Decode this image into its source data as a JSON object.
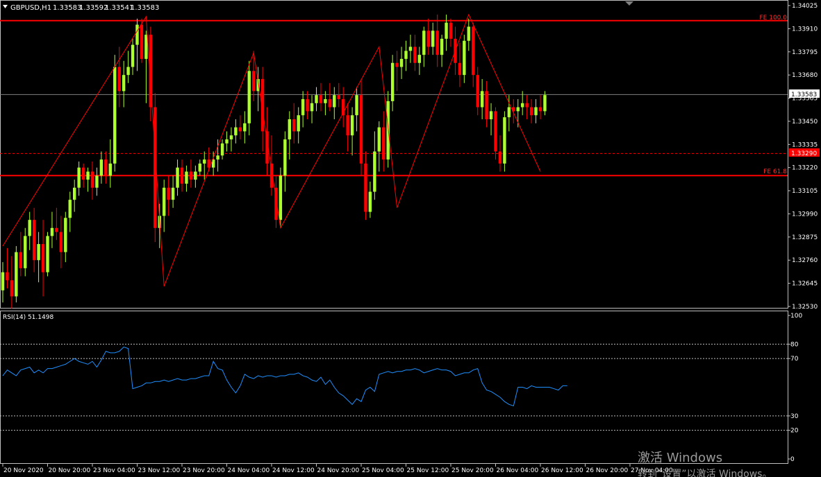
{
  "symbol_header": {
    "symbol": "GBPUSD,H1",
    "open": "1.33583",
    "high": "1.33592",
    "low": "1.33541",
    "close": "1.33583"
  },
  "price_axis": {
    "ticks": [
      "1.34025",
      "1.33910",
      "1.33795",
      "1.33680",
      "1.33565",
      "1.33450",
      "1.33335",
      "1.33220",
      "1.33105",
      "1.32990",
      "1.32875",
      "1.32760",
      "1.32645",
      "1.32530"
    ],
    "current_price_label": "1.33583",
    "dashed_level_label": "1.33290"
  },
  "fe_levels": [
    {
      "label": "FE 100.0",
      "price": 1.3395
    },
    {
      "label": "FE 61.8",
      "price": 1.3318
    }
  ],
  "time_axis": {
    "labels": [
      "20 Nov 2020",
      "20 Nov 20:00",
      "23 Nov 04:00",
      "23 Nov 12:00",
      "23 Nov 20:00",
      "24 Nov 04:00",
      "24 Nov 12:00",
      "24 Nov 20:00",
      "25 Nov 04:00",
      "25 Nov 12:00",
      "25 Nov 20:00",
      "26 Nov 04:00",
      "26 Nov 12:00",
      "26 Nov 20:00",
      "27 Nov 04:00"
    ]
  },
  "rsi_panel": {
    "label": "RSI(14) 51.1498",
    "ticks": [
      "100",
      "80",
      "70",
      "30",
      "20",
      "0"
    ],
    "levels": [
      80,
      70,
      30,
      20
    ]
  },
  "watermark": {
    "line1": "激活 Windows",
    "line2": "转到“设置”以激活 Windows。"
  },
  "colors": {
    "background": "#000000",
    "bull": "#adff2f",
    "bear": "#ff0000",
    "fe_line": "#ff0000",
    "zigzag": "#ff0000",
    "rsi_line": "#1e90ff",
    "axis_text": "#ffffff",
    "price_marker_bg": "#ffffff",
    "level_marker_bg": "#ff0000"
  },
  "chart_data": {
    "type": "candlestick",
    "title": "GBPUSD,H1",
    "ylim": [
      1.3253,
      1.34025
    ],
    "candles": [
      [
        1.3261,
        1.3275,
        1.3255,
        1.327
      ],
      [
        1.327,
        1.3282,
        1.3262,
        1.3266
      ],
      [
        1.3266,
        1.3278,
        1.3252,
        1.3258
      ],
      [
        1.3258,
        1.3283,
        1.3255,
        1.328
      ],
      [
        1.328,
        1.329,
        1.3268,
        1.3272
      ],
      [
        1.3272,
        1.3292,
        1.3268,
        1.3288
      ],
      [
        1.3288,
        1.33,
        1.3281,
        1.3296
      ],
      [
        1.3296,
        1.3302,
        1.327,
        1.3276
      ],
      [
        1.3276,
        1.329,
        1.3265,
        1.3284
      ],
      [
        1.3284,
        1.3296,
        1.3258,
        1.327
      ],
      [
        1.327,
        1.329,
        1.3268,
        1.3288
      ],
      [
        1.3288,
        1.33,
        1.3282,
        1.3292
      ],
      [
        1.3292,
        1.3302,
        1.3286,
        1.329
      ],
      [
        1.329,
        1.3298,
        1.3272,
        1.328
      ],
      [
        1.328,
        1.33,
        1.3275,
        1.3297
      ],
      [
        1.3297,
        1.331,
        1.329,
        1.3306
      ],
      [
        1.3306,
        1.3316,
        1.33,
        1.3312
      ],
      [
        1.3312,
        1.3325,
        1.3308,
        1.3322
      ],
      [
        1.3322,
        1.3324,
        1.3312,
        1.3316
      ],
      [
        1.3316,
        1.3322,
        1.331,
        1.332
      ],
      [
        1.332,
        1.3325,
        1.3306,
        1.3312
      ],
      [
        1.3312,
        1.3322,
        1.3308,
        1.3318
      ],
      [
        1.3318,
        1.333,
        1.3314,
        1.3326
      ],
      [
        1.3326,
        1.333,
        1.3314,
        1.3318
      ],
      [
        1.3318,
        1.3336,
        1.3312,
        1.3324
      ],
      [
        1.3324,
        1.3378,
        1.332,
        1.3372
      ],
      [
        1.3372,
        1.3382,
        1.3352,
        1.336
      ],
      [
        1.336,
        1.3375,
        1.3352,
        1.3368
      ],
      [
        1.3368,
        1.338,
        1.3364,
        1.3372
      ],
      [
        1.3372,
        1.3386,
        1.3368,
        1.3383
      ],
      [
        1.3383,
        1.3396,
        1.337,
        1.3393
      ],
      [
        1.3393,
        1.3396,
        1.3374,
        1.3376
      ],
      [
        1.3376,
        1.339,
        1.3354,
        1.3388
      ],
      [
        1.3388,
        1.3392,
        1.3345,
        1.3352
      ],
      [
        1.3352,
        1.3359,
        1.3285,
        1.3292
      ],
      [
        1.3292,
        1.3304,
        1.3282,
        1.3298
      ],
      [
        1.3298,
        1.3316,
        1.329,
        1.3312
      ],
      [
        1.3312,
        1.3318,
        1.3298,
        1.3306
      ],
      [
        1.3306,
        1.3318,
        1.3302,
        1.3312
      ],
      [
        1.3312,
        1.3326,
        1.3308,
        1.3322
      ],
      [
        1.3322,
        1.3326,
        1.331,
        1.3314
      ],
      [
        1.3314,
        1.3323,
        1.331,
        1.332
      ],
      [
        1.332,
        1.3326,
        1.3312,
        1.3316
      ],
      [
        1.3316,
        1.3323,
        1.3312,
        1.332
      ],
      [
        1.332,
        1.3326,
        1.3318,
        1.3324
      ],
      [
        1.3324,
        1.333,
        1.3316,
        1.3326
      ],
      [
        1.3326,
        1.3332,
        1.332,
        1.3322
      ],
      [
        1.3322,
        1.333,
        1.3318,
        1.3326
      ],
      [
        1.3326,
        1.3336,
        1.332,
        1.3328
      ],
      [
        1.3328,
        1.3336,
        1.3326,
        1.3334
      ],
      [
        1.3334,
        1.334,
        1.333,
        1.3336
      ],
      [
        1.3336,
        1.3342,
        1.333,
        1.3338
      ],
      [
        1.3338,
        1.3346,
        1.3334,
        1.3342
      ],
      [
        1.3342,
        1.3348,
        1.3336,
        1.334
      ],
      [
        1.334,
        1.335,
        1.3334,
        1.3344
      ],
      [
        1.3344,
        1.3375,
        1.3338,
        1.337
      ],
      [
        1.337,
        1.338,
        1.3355,
        1.336
      ],
      [
        1.336,
        1.3372,
        1.335,
        1.3366
      ],
      [
        1.3366,
        1.3372,
        1.333,
        1.334
      ],
      [
        1.334,
        1.3352,
        1.3318,
        1.3324
      ],
      [
        1.3324,
        1.3338,
        1.3308,
        1.3312
      ],
      [
        1.3312,
        1.3318,
        1.3292,
        1.3296
      ],
      [
        1.3296,
        1.3322,
        1.3292,
        1.3318
      ],
      [
        1.3318,
        1.334,
        1.331,
        1.3336
      ],
      [
        1.3336,
        1.335,
        1.3326,
        1.3346
      ],
      [
        1.3346,
        1.3354,
        1.3334,
        1.334
      ],
      [
        1.334,
        1.3352,
        1.3334,
        1.3348
      ],
      [
        1.3348,
        1.336,
        1.3342,
        1.3356
      ],
      [
        1.3356,
        1.336,
        1.3346,
        1.335
      ],
      [
        1.335,
        1.3358,
        1.3344,
        1.3354
      ],
      [
        1.3354,
        1.3362,
        1.335,
        1.3358
      ],
      [
        1.3358,
        1.3364,
        1.335,
        1.3354
      ],
      [
        1.3354,
        1.336,
        1.3348,
        1.3356
      ],
      [
        1.3356,
        1.3364,
        1.335,
        1.3352
      ],
      [
        1.3352,
        1.3362,
        1.3346,
        1.3358
      ],
      [
        1.3358,
        1.3364,
        1.3352,
        1.3356
      ],
      [
        1.3356,
        1.3362,
        1.3342,
        1.3348
      ],
      [
        1.3348,
        1.3354,
        1.333,
        1.3338
      ],
      [
        1.3338,
        1.3352,
        1.3328,
        1.3348
      ],
      [
        1.3348,
        1.3362,
        1.334,
        1.3358
      ],
      [
        1.3358,
        1.3366,
        1.3318,
        1.3324
      ],
      [
        1.3324,
        1.333,
        1.3296,
        1.33
      ],
      [
        1.33,
        1.3315,
        1.3297,
        1.331
      ],
      [
        1.331,
        1.334,
        1.3306,
        1.333
      ],
      [
        1.333,
        1.3345,
        1.332,
        1.3342
      ],
      [
        1.3342,
        1.335,
        1.332,
        1.3326
      ],
      [
        1.3326,
        1.336,
        1.3322,
        1.3355
      ],
      [
        1.3355,
        1.3378,
        1.335,
        1.3374
      ],
      [
        1.3374,
        1.338,
        1.336,
        1.3372
      ],
      [
        1.3372,
        1.3382,
        1.3366,
        1.3376
      ],
      [
        1.3376,
        1.3385,
        1.337,
        1.338
      ],
      [
        1.338,
        1.3388,
        1.3374,
        1.3382
      ],
      [
        1.3382,
        1.3388,
        1.337,
        1.3374
      ],
      [
        1.3374,
        1.3382,
        1.3368,
        1.3378
      ],
      [
        1.3378,
        1.3392,
        1.3372,
        1.339
      ],
      [
        1.339,
        1.3396,
        1.3378,
        1.3382
      ],
      [
        1.3382,
        1.3394,
        1.3378,
        1.339
      ],
      [
        1.339,
        1.3398,
        1.3372,
        1.3378
      ],
      [
        1.3378,
        1.3388,
        1.3372,
        1.3386
      ],
      [
        1.3386,
        1.3398,
        1.338,
        1.3394
      ],
      [
        1.3394,
        1.3396,
        1.3382,
        1.3386
      ],
      [
        1.3386,
        1.3392,
        1.3368,
        1.3374
      ],
      [
        1.3374,
        1.3384,
        1.3362,
        1.3368
      ],
      [
        1.3368,
        1.3388,
        1.3364,
        1.3385
      ],
      [
        1.3385,
        1.3396,
        1.338,
        1.3392
      ],
      [
        1.3392,
        1.3394,
        1.3362,
        1.3368
      ],
      [
        1.3368,
        1.3372,
        1.3348,
        1.3352
      ],
      [
        1.3352,
        1.3366,
        1.3346,
        1.336
      ],
      [
        1.336,
        1.3365,
        1.3342,
        1.3346
      ],
      [
        1.3346,
        1.3354,
        1.3338,
        1.335
      ],
      [
        1.335,
        1.3352,
        1.3326,
        1.333
      ],
      [
        1.333,
        1.3338,
        1.332,
        1.3324
      ],
      [
        1.3324,
        1.335,
        1.332,
        1.3347
      ],
      [
        1.3347,
        1.3358,
        1.334,
        1.3352
      ],
      [
        1.3352,
        1.3356,
        1.3344,
        1.335
      ],
      [
        1.335,
        1.3356,
        1.3342,
        1.3352
      ],
      [
        1.3352,
        1.336,
        1.3348,
        1.3354
      ],
      [
        1.3354,
        1.3358,
        1.3346,
        1.3352
      ],
      [
        1.3352,
        1.3356,
        1.3344,
        1.3348
      ],
      [
        1.3348,
        1.3356,
        1.3344,
        1.3352
      ],
      [
        1.3352,
        1.3358,
        1.3346,
        1.335
      ],
      [
        1.335,
        1.336,
        1.3348,
        1.3358
      ]
    ],
    "zigzag": [
      {
        "bar": 0,
        "price": 1.3283
      },
      {
        "bar": 32,
        "price": 1.3397
      },
      {
        "bar": 36,
        "price": 1.3263
      },
      {
        "bar": 56,
        "price": 1.3379
      },
      {
        "bar": 62,
        "price": 1.3292
      },
      {
        "bar": 84,
        "price": 1.3382
      },
      {
        "bar": 88,
        "price": 1.3302
      },
      {
        "bar": 104,
        "price": 1.3398
      },
      {
        "bar": 120,
        "price": 1.332
      }
    ],
    "rsi": [
      58,
      62,
      60,
      58,
      62,
      63,
      64,
      60,
      62,
      60,
      63,
      63,
      64,
      65,
      66,
      68,
      70,
      68,
      67,
      66,
      68,
      64,
      69,
      75,
      74,
      74,
      75,
      78,
      77,
      49,
      50,
      51,
      53,
      53,
      54,
      54,
      55,
      54,
      55,
      56,
      55,
      55,
      56,
      56,
      57,
      58,
      58,
      68,
      63,
      62,
      55,
      50,
      46,
      51,
      59,
      57,
      56,
      58,
      57,
      58,
      58,
      57,
      58,
      58,
      59,
      59,
      60,
      58,
      57,
      55,
      54,
      57,
      52,
      55,
      50,
      46,
      44,
      41,
      38,
      42,
      40,
      48,
      50,
      47,
      59,
      60,
      61,
      60,
      61,
      61,
      62,
      62,
      63,
      62,
      60,
      61,
      62,
      63,
      62,
      62,
      61,
      58,
      59,
      60,
      60,
      62,
      63,
      53,
      48,
      47,
      45,
      43,
      40,
      38,
      37,
      50,
      50,
      49,
      51,
      50,
      50,
      50,
      50,
      49,
      48,
      51,
      51
    ],
    "rsi_ylim": [
      0,
      100
    ],
    "rsi_levels": [
      80,
      70,
      30,
      20
    ]
  }
}
